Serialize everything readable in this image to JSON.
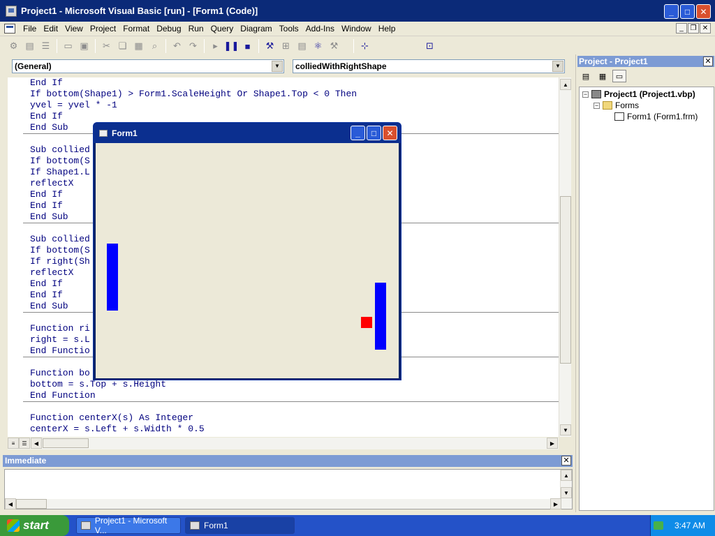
{
  "window": {
    "title": "Project1 - Microsoft Visual Basic [run] - [Form1 (Code)]",
    "minimize": "_",
    "maximize": "□",
    "close": "✕"
  },
  "menu": {
    "items": [
      "File",
      "Edit",
      "View",
      "Project",
      "Format",
      "Debug",
      "Run",
      "Query",
      "Diagram",
      "Tools",
      "Add-Ins",
      "Window",
      "Help"
    ]
  },
  "toolbar": {
    "buttons": [
      "add-project",
      "add-form",
      "menu-editor",
      "open",
      "save",
      "cut",
      "copy",
      "paste",
      "find",
      "undo",
      "redo",
      "start",
      "break",
      "end",
      "project-explorer",
      "properties",
      "form-layout",
      "object-browser",
      "toolbox",
      "position",
      "size"
    ]
  },
  "code_window": {
    "object_combo": "(General)",
    "procedure_combo": "colliedWithRightShape",
    "lines": [
      "End If",
      "If bottom(Shape1) > Form1.ScaleHeight Or Shape1.Top < 0 Then",
      "yvel = yvel * -1",
      "End If",
      "End Sub",
      "",
      "Sub collied",
      "If bottom(S",
      "If Shape1.L",
      "reflectX",
      "End If",
      "End If",
      "End Sub",
      "",
      "Sub collied",
      "If bottom(S",
      "If right(Sh",
      "reflectX",
      "End If",
      "End If",
      "End Sub",
      "",
      "Function ri",
      "right = s.L",
      "End Functio",
      "",
      "Function bo",
      "bottom = s.Top + s.Height",
      "End Function",
      "",
      "Function centerX(s) As Integer",
      "centerX = s.Left + s.Width * 0.5"
    ]
  },
  "immediate": {
    "title": "Immediate",
    "close": "✕"
  },
  "project_explorer": {
    "title": "Project - Project1",
    "close": "✕",
    "tree": {
      "project": "Project1 (Project1.vbp)",
      "folder": "Forms",
      "form": "Form1 (Form1.frm)"
    }
  },
  "form1": {
    "title": "Form1",
    "minimize": "_",
    "maximize": "□",
    "close": "✕",
    "colors": {
      "paddle": "#0000ff",
      "ball": "#ff0000",
      "background": "#ece9d8"
    }
  },
  "taskbar": {
    "start": "start",
    "tasks": [
      "Project1 - Microsoft V...",
      "Form1"
    ],
    "clock": "3:47 AM"
  }
}
